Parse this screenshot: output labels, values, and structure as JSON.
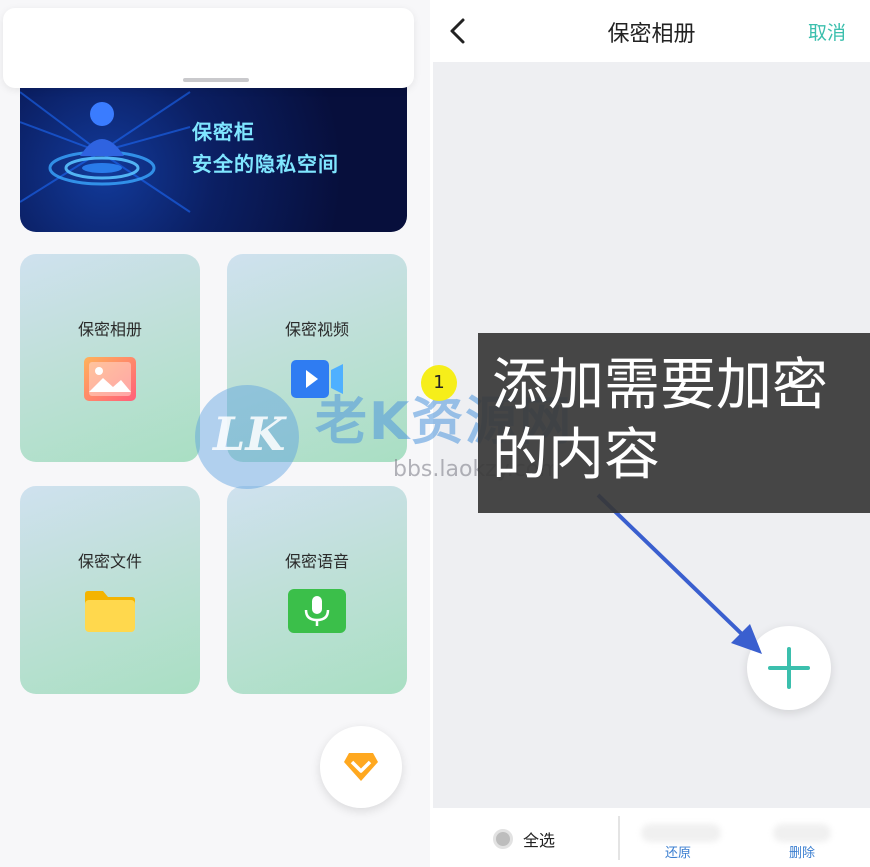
{
  "left": {
    "banner": {
      "title": "保密柜",
      "subtitle": "安全的隐私空间"
    },
    "tiles": [
      {
        "label": "保密相册",
        "icon": "image-icon"
      },
      {
        "label": "保密视频",
        "icon": "video-icon"
      },
      {
        "label": "保密文件",
        "icon": "folder-icon"
      },
      {
        "label": "保密语音",
        "icon": "microphone-icon"
      }
    ],
    "vip_icon": "diamond-icon"
  },
  "right": {
    "nav": {
      "title": "保密相册",
      "cancel_label": "取消",
      "back_icon": "chevron-left-icon"
    },
    "add_icon": "plus-icon",
    "bottom_bar": {
      "select_all_label": "全选",
      "restore_label": "还原",
      "delete_label": "删除"
    }
  },
  "overlay": {
    "step_number": "1",
    "tooltip_text": "添加需要加密的内容",
    "watermark_text": "老K资源网",
    "watermark_url": "bbs.laokzy.com",
    "watermark_logo": "LK"
  },
  "colors": {
    "accent": "#3bbfad",
    "banner_text": "#7fe6ff",
    "tooltip_bg": "#373737",
    "badge": "#f6ee1a",
    "arrow": "#3a5fcf"
  }
}
